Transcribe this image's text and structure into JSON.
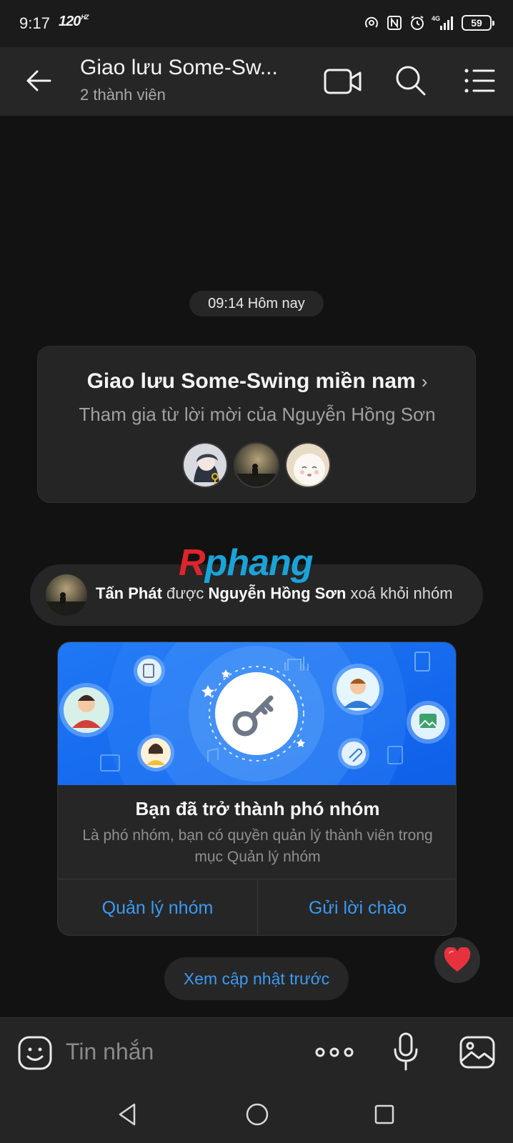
{
  "status_bar": {
    "time": "9:17",
    "refresh_rate": "120",
    "refresh_unit": "HZ",
    "network": "4G",
    "battery": "59"
  },
  "header": {
    "title": "Giao lưu Some-Sw...",
    "subtitle": "2 thành viên"
  },
  "chat": {
    "timestamp": "09:14 Hôm nay",
    "group_card": {
      "name": "Giao lưu Some-Swing miền nam",
      "invite_text": "Tham gia từ lời mời của Nguyễn Hồng Sơn"
    },
    "watermark": {
      "part1": "R",
      "part2": "phang"
    },
    "notice": {
      "actor": "Tấn Phát",
      "verb": " được ",
      "by": "Nguyễn Hồng Sơn",
      "action": " xoá khỏi nhóm"
    },
    "promo": {
      "title": "Bạn đã trở thành phó nhóm",
      "description": "Là phó nhóm, bạn có quyền quản lý thành viên trong mục Quản lý nhóm",
      "manage_label": "Quản lý nhóm",
      "greet_label": "Gửi lời chào"
    },
    "previous_updates_label": "Xem cập nhật trước"
  },
  "composer": {
    "placeholder": "Tin nhắn"
  },
  "colors": {
    "accent": "#3a9af2",
    "background": "#121212",
    "surface": "#262626",
    "heart": "#e8313f"
  },
  "icons": [
    "back-icon",
    "video-call-icon",
    "search-icon",
    "menu-icon",
    "chevron-right-icon",
    "heart-icon",
    "emoji-icon",
    "more-icon",
    "mic-icon",
    "image-icon"
  ]
}
